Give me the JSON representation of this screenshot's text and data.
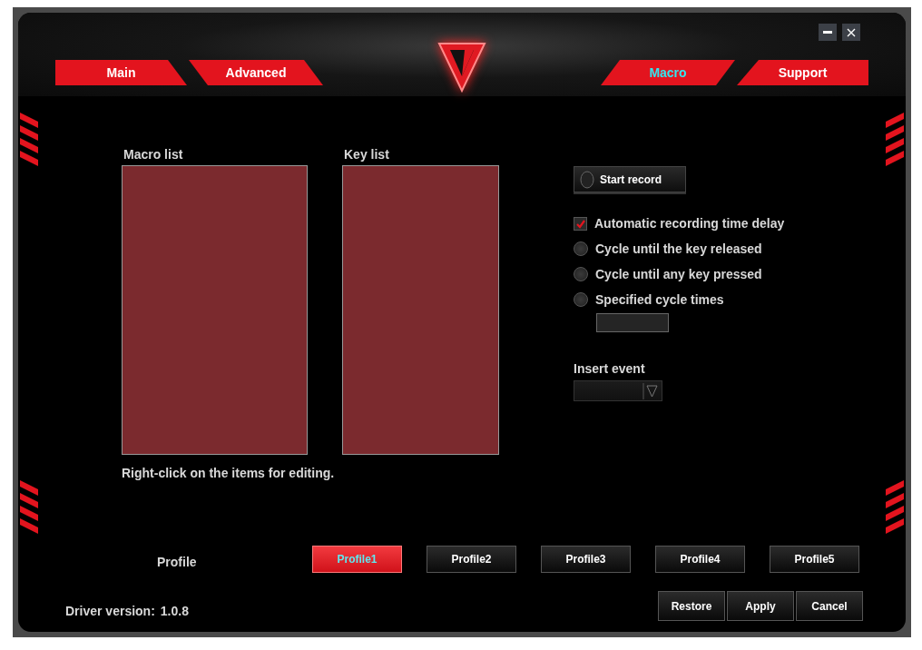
{
  "tabs": [
    {
      "label": "Main",
      "selected": false
    },
    {
      "label": "Advanced",
      "selected": false
    },
    {
      "label": "Macro",
      "selected": true
    },
    {
      "label": "Support",
      "selected": false
    }
  ],
  "macro_list": {
    "label": "Macro list"
  },
  "key_list": {
    "label": "Key list"
  },
  "hint": "Right-click on the items for editing.",
  "start_record_button": "Start record",
  "options": [
    {
      "kind": "checkbox",
      "label": "Automatic recording time delay",
      "checked": true
    },
    {
      "kind": "radio",
      "label": "Cycle until the key released",
      "checked": false
    },
    {
      "kind": "radio",
      "label": "Cycle until any key pressed",
      "checked": false
    },
    {
      "kind": "radio",
      "label": "Specified cycle times",
      "checked": false
    }
  ],
  "insert_event": {
    "label": "Insert event"
  },
  "profile_label": "Profile",
  "profiles": [
    {
      "label": "Profile1",
      "selected": true
    },
    {
      "label": "Profile2",
      "selected": false
    },
    {
      "label": "Profile3",
      "selected": false
    },
    {
      "label": "Profile4",
      "selected": false
    },
    {
      "label": "Profile5",
      "selected": false
    }
  ],
  "driver_version": {
    "label": "Driver version:",
    "value": "1.0.8"
  },
  "buttons": [
    "Restore",
    "Apply",
    "Cancel"
  ]
}
